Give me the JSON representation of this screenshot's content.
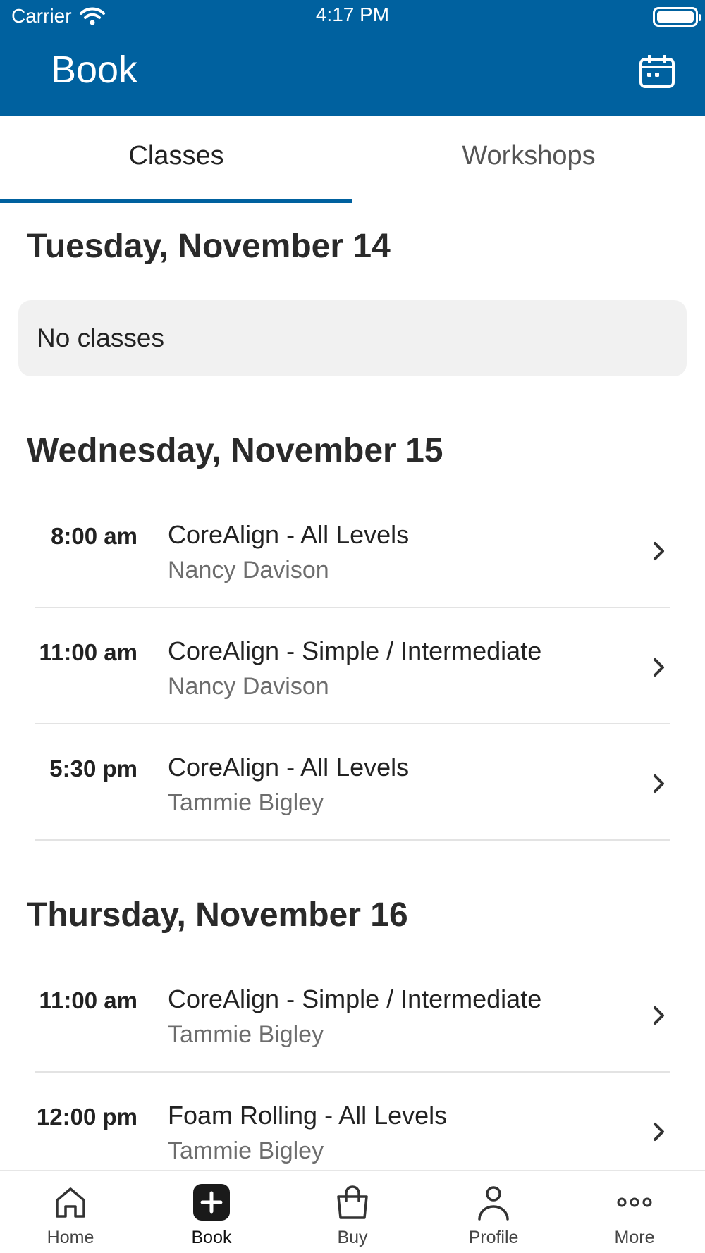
{
  "status_bar": {
    "carrier": "Carrier",
    "time": "4:17 PM"
  },
  "header": {
    "title": "Book",
    "calendar_icon": "calendar-icon"
  },
  "tabs": [
    {
      "label": "Classes",
      "active": true
    },
    {
      "label": "Workshops",
      "active": false
    }
  ],
  "days": [
    {
      "heading": "Tuesday, November 14",
      "empty_text": "No classes",
      "classes": []
    },
    {
      "heading": "Wednesday, November 15",
      "classes": [
        {
          "time": "8:00 am",
          "name": "CoreAlign - All Levels",
          "instructor": "Nancy Davison"
        },
        {
          "time": "11:00 am",
          "name": "CoreAlign - Simple / Intermediate",
          "instructor": "Nancy Davison"
        },
        {
          "time": "5:30 pm",
          "name": "CoreAlign - All Levels",
          "instructor": "Tammie Bigley"
        }
      ]
    },
    {
      "heading": "Thursday, November 16",
      "classes": [
        {
          "time": "11:00 am",
          "name": "CoreAlign - Simple / Intermediate",
          "instructor": "Tammie Bigley"
        },
        {
          "time": "12:00 pm",
          "name": "Foam Rolling - All Levels",
          "instructor": "Tammie Bigley"
        }
      ]
    }
  ],
  "bottom_nav": [
    {
      "label": "Home",
      "icon": "home-icon",
      "active": false
    },
    {
      "label": "Book",
      "icon": "plus-icon",
      "active": true
    },
    {
      "label": "Buy",
      "icon": "shopping-bag-icon",
      "active": false
    },
    {
      "label": "Profile",
      "icon": "person-icon",
      "active": false
    },
    {
      "label": "More",
      "icon": "more-icon",
      "active": false
    }
  ],
  "colors": {
    "brand": "#00619f",
    "active_nav": "#1a1a1a",
    "muted_text": "#6d6d6d"
  }
}
